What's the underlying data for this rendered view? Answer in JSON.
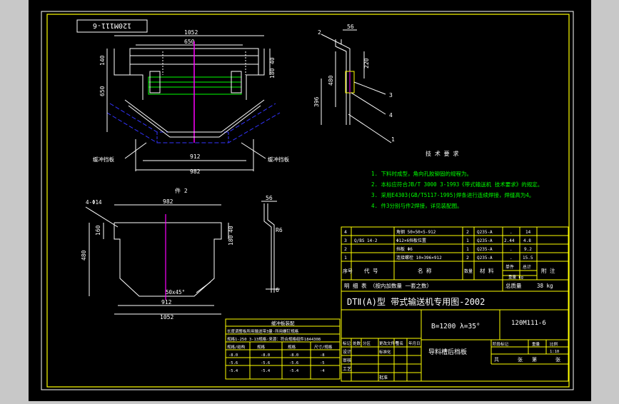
{
  "viewport": {
    "background": "#c8c8c8",
    "paper": "#000000"
  },
  "colors": {
    "white": "#ffffff",
    "yellow": "#ffff00",
    "green": "#00ff00",
    "magenta": "#ff00ff",
    "blue": "#3333ff",
    "cyan": "#00ffff"
  },
  "drawing": {
    "number_box": "120M111-6",
    "view_top": {
      "dim_width_total": "1052",
      "dim_inner": "650",
      "dim_left_h1": "140",
      "dim_left_h2": "650",
      "dim_right_h1": "40",
      "dim_right_h2": "180",
      "dim_bottom_1": "912",
      "dim_bottom_2": "982",
      "label_left": "缓冲挡板",
      "label_right": "缓冲挡板"
    },
    "view_side": {
      "dim_top": "56",
      "dim_h1": "220",
      "dim_h2": "480",
      "dim_h3": "396",
      "balloons": [
        "2",
        "3",
        "4",
        "1"
      ]
    },
    "view_part2": {
      "title": "件 2",
      "holes": "4-Φ14",
      "dim_top": "982",
      "dim_left_h1": "160",
      "dim_left_h2": "480",
      "dim_right_h1": "40",
      "dim_right_h2": "180",
      "chamfer": "50x45°",
      "dim_bottom_1": "912",
      "dim_bottom_2": "1052",
      "side_dim_top": "56",
      "side_radius": "R6",
      "side_thick": "6"
    },
    "tech_requirements": {
      "title": "技 术 要 求",
      "lines": [
        "1. 下料时成型，角向孔胶铆固的规程为。",
        "2. 本标应符合JB/T 3000 3-1993《带式输送机 技术要求》的规定。",
        "3. 采用E4303(GB/T5117-1995)焊条进行连续焊接，焊缝高为4。",
        "4. 件3分别与件2焊接，详见装配图。"
      ]
    },
    "left_table": {
      "title": "缓冲板装配",
      "rows": [
        [
          "长度调整板所用输送带3量·所用螺钉规格"
        ],
        [
          "规格1-250 3-13规格·来源：符合规格组件1844308"
        ],
        [
          "规格/结构",
          "规格",
          "规格",
          "尺寸/规格"
        ],
        [
          "-8.0",
          "-8.0",
          "-8.0",
          "-8"
        ],
        [
          "-5.6",
          "-5.6",
          "-5.6",
          "-5"
        ],
        [
          "-5.4",
          "-5.4",
          "-5.4",
          "-4"
        ]
      ]
    },
    "parts_list": {
      "rows": [
        [
          "4",
          "",
          "角钢 50×50×5-912",
          "2",
          "Q235-A",
          ".",
          "14"
        ],
        [
          "3",
          "Q/BS 14-2",
          "Φ12×6挡板位置",
          "1",
          "Q235-A",
          "2.44",
          "4.8"
        ],
        [
          "2",
          "",
          "挡板 Φ6",
          "1",
          "Q235-A",
          ".",
          "9.2"
        ],
        [
          "1",
          "",
          "连接螺栓 10×396×912",
          "2",
          "Q235-A",
          ".",
          "15.5"
        ]
      ],
      "header": [
        "序号",
        "代 号",
        "名 称",
        "数量",
        "材 料",
        "单件",
        "总计",
        "附 注"
      ],
      "weight_label": "重量 kg",
      "detail_label": "明 细 表 （按内加数量 一套之数）",
      "total_weight_label": "总质量",
      "total_weight_value": "38 kg"
    },
    "title_block": {
      "series_title": "DTⅡ(A)型 带式输送机专用图-2002",
      "spec": "B=1200 λ=35°",
      "drawing_no": "120M111-6",
      "part_name": "导料槽后档板",
      "labels": [
        "标记",
        "处数",
        "分区",
        "更改文件号",
        "签名",
        "年月日"
      ],
      "labels2": [
        "设计",
        "标准化",
        "审核",
        "工艺",
        "批准"
      ],
      "stage_labels": [
        "阶段标记",
        "重量",
        "比例"
      ],
      "scale": "1:10",
      "sheet": [
        "共",
        "张",
        "第",
        "张"
      ]
    }
  }
}
